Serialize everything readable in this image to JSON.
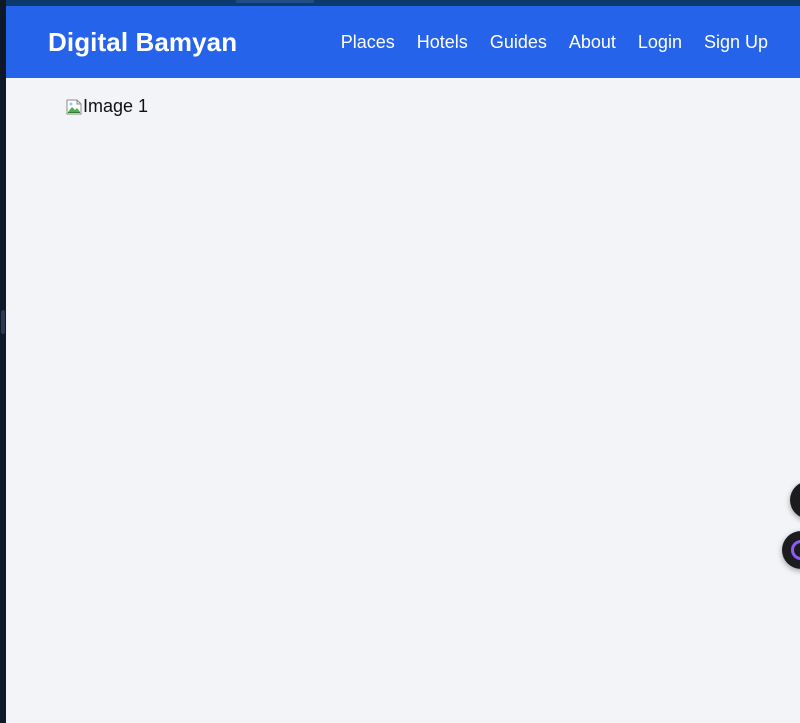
{
  "header": {
    "brand": "Digital Bamyan",
    "nav": [
      {
        "label": "Places"
      },
      {
        "label": "Hotels"
      },
      {
        "label": "Guides"
      },
      {
        "label": "About"
      },
      {
        "label": "Login"
      },
      {
        "label": "Sign Up"
      }
    ]
  },
  "main": {
    "image": {
      "alt": "Image 1",
      "icon": "broken-image-icon"
    }
  },
  "floating": {
    "top_button_icon": "dark-circle-icon",
    "bottom_button_icon": "purple-ring-icon"
  },
  "colors": {
    "navbar": "#2563eb",
    "page_background": "#f2f4f7",
    "brand_text": "#ffffff",
    "fab": "#1c1c1e",
    "fab_accent": "#8b5cf6"
  }
}
